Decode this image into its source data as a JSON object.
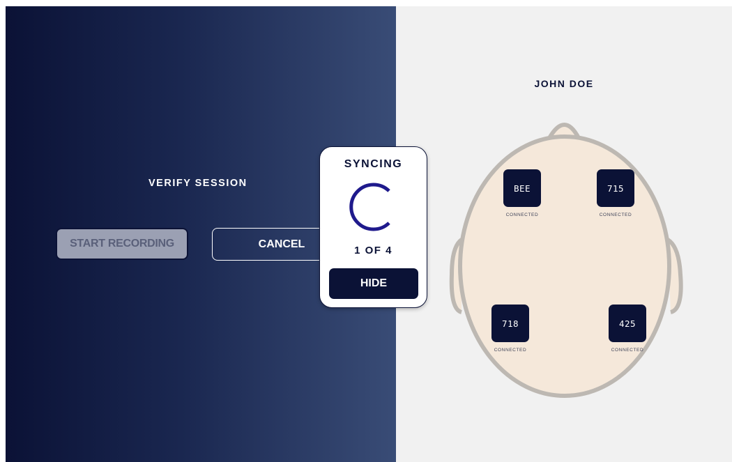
{
  "session": {
    "title": "VERIFY SESSION",
    "start_label": "START RECORDING",
    "cancel_label": "CANCEL"
  },
  "person": {
    "name": "JOHN DOE"
  },
  "sensors": [
    {
      "id": "BEE",
      "status": "CONNECTED"
    },
    {
      "id": "715",
      "status": "CONNECTED"
    },
    {
      "id": "718",
      "status": "CONNECTED"
    },
    {
      "id": "425",
      "status": "CONNECTED"
    }
  ],
  "sync_modal": {
    "title": "SYNCING",
    "progress": "1 OF 4",
    "hide_label": "HIDE",
    "spinner_icon": "loading-spinner-icon"
  },
  "colors": {
    "navy": "#0b1236",
    "head_fill": "#f5e8da",
    "head_outline": "#bdb8b2",
    "spinner": "#1f1a8c"
  }
}
